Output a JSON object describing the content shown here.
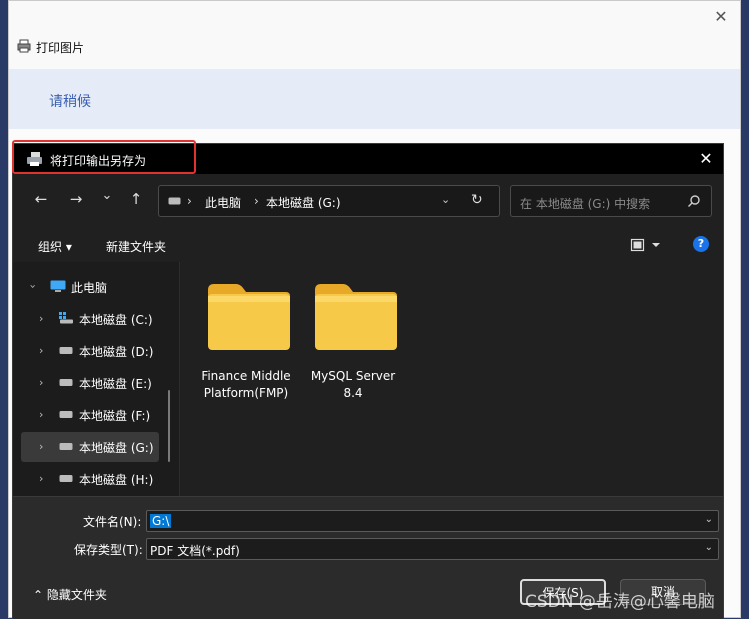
{
  "print_window": {
    "title": "打印图片",
    "close_glyph": "✕",
    "status": "请稍候"
  },
  "save_dialog": {
    "title": "将打印输出另存为",
    "close_glyph": "✕",
    "nav": {
      "back_glyph": "←",
      "forward_glyph": "→",
      "recent_glyph": "⌄",
      "up_glyph": "↑"
    },
    "address": {
      "crumbs": [
        "此电脑",
        "本地磁盘 (G:)"
      ],
      "separator": "›",
      "dropdown_glyph": "⌄",
      "refresh_glyph": "↻"
    },
    "search": {
      "placeholder": "在 本地磁盘 (G:) 中搜索"
    },
    "toolbar": {
      "organize": "组织 ▾",
      "new_folder": "新建文件夹",
      "help": "?"
    },
    "sidebar": {
      "root": "此电脑",
      "items": [
        {
          "label": "本地磁盘 (C:)",
          "selected": false
        },
        {
          "label": "本地磁盘 (D:)",
          "selected": false
        },
        {
          "label": "本地磁盘 (E:)",
          "selected": false
        },
        {
          "label": "本地磁盘 (F:)",
          "selected": false
        },
        {
          "label": "本地磁盘 (G:)",
          "selected": true
        },
        {
          "label": "本地磁盘 (H:)",
          "selected": false
        }
      ]
    },
    "files": [
      {
        "name_line1": "Finance Middle",
        "name_line2": "Platform(FMP)"
      },
      {
        "name_line1": "MySQL Server",
        "name_line2": "8.4"
      }
    ],
    "form": {
      "filename_label": "文件名(N):",
      "filename_value": "G:\\",
      "filetype_label": "保存类型(T):",
      "filetype_value": "PDF 文档(*.pdf)",
      "dropdown_glyph": "⌄",
      "hide_folders": "⌃  隐藏文件夹",
      "save": "保存(S)",
      "cancel": "取消"
    },
    "colors": {
      "accent": "#0078d4",
      "folder": "#f7c948",
      "highlight_box": "#e0332f"
    }
  },
  "watermark": "CSDN @岳涛@心馨电脑"
}
